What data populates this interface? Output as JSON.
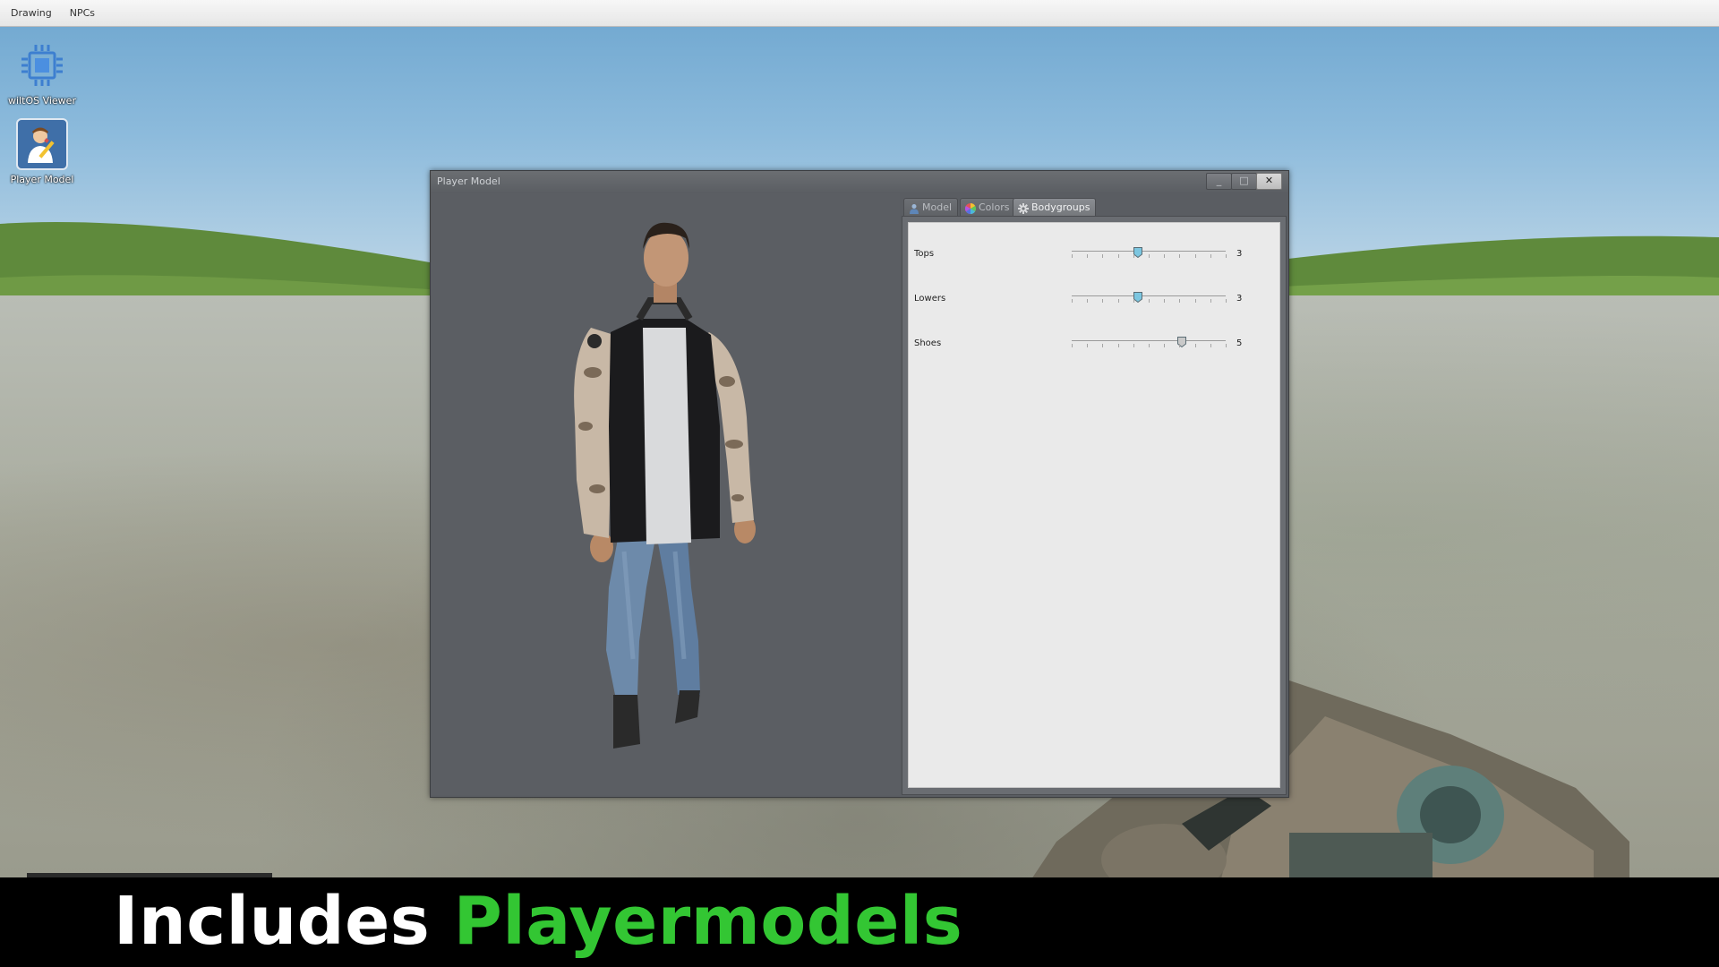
{
  "menubar": {
    "items": [
      "Drawing",
      "NPCs"
    ]
  },
  "desktop": {
    "icons": [
      {
        "label": "wiltOS Viewer",
        "icon": "chip-icon"
      },
      {
        "label": "Player Model",
        "icon": "player-model-icon"
      }
    ]
  },
  "window": {
    "title": "Player Model",
    "controls": {
      "minimize": "_",
      "maximize": "□",
      "close": "✕"
    },
    "tabs": [
      {
        "label": "Model",
        "icon": "person-icon",
        "active": false
      },
      {
        "label": "Colors",
        "icon": "color-wheel-icon",
        "active": false
      },
      {
        "label": "Bodygroups",
        "icon": "gear-icon",
        "active": true
      }
    ],
    "bodygroups": [
      {
        "label": "Tops",
        "value": "3",
        "level": 3,
        "max": 7
      },
      {
        "label": "Lowers",
        "value": "3",
        "level": 3,
        "max": 7
      },
      {
        "label": "Shoes",
        "value": "5",
        "level": 5,
        "max": 7
      }
    ]
  },
  "caption": {
    "part1": "Includes",
    "part2": "Playermodels"
  },
  "colors": {
    "accent_green": "#33c633",
    "knob_blue": "#7cc6e0"
  }
}
